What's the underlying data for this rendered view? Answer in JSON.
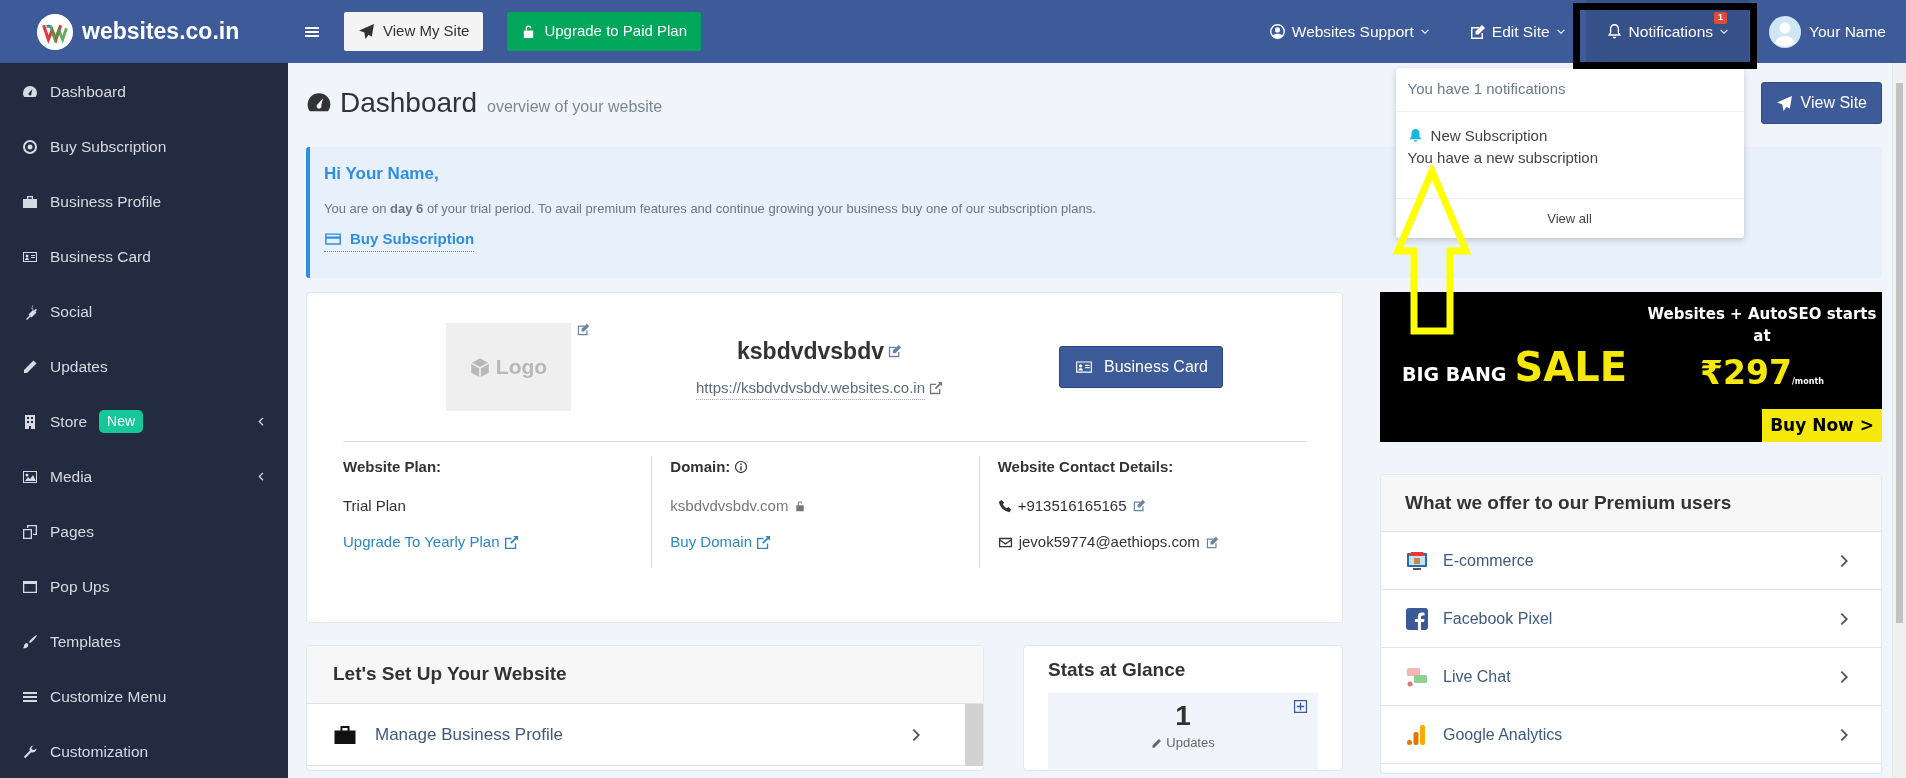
{
  "brand": {
    "name": "websites.co.in"
  },
  "topbar": {
    "buttons": [
      {
        "label": "View My Site",
        "kind": "light"
      },
      {
        "label": "Upgrade to Paid Plan",
        "kind": "success"
      }
    ],
    "menus": [
      {
        "label": "Websites Support"
      },
      {
        "label": "Edit Site"
      }
    ],
    "notifications": {
      "label": "Notifications",
      "badge": "1",
      "expanded": true
    },
    "user": {
      "name": "Your Name"
    }
  },
  "notification_menu": {
    "header": "You have 1 notifications",
    "items": [
      {
        "title": "New Subscription",
        "text": "You have a new subscription"
      }
    ],
    "footer": "View all"
  },
  "sidebar": {
    "items": [
      {
        "label": "Dashboard",
        "expandable": false
      },
      {
        "label": "Buy Subscription",
        "expandable": false
      },
      {
        "label": "Business Profile",
        "expandable": false
      },
      {
        "label": "Business Card",
        "expandable": false
      },
      {
        "label": "Social",
        "expandable": false
      },
      {
        "label": "Updates",
        "expandable": false
      },
      {
        "label": "Store",
        "badge": "New",
        "expandable": true
      },
      {
        "label": "Media",
        "expandable": true
      },
      {
        "label": "Pages",
        "expandable": false
      },
      {
        "label": "Pop Ups",
        "expandable": false
      },
      {
        "label": "Templates",
        "expandable": false
      },
      {
        "label": "Customize Menu",
        "expandable": false
      },
      {
        "label": "Customization",
        "expandable": false
      }
    ]
  },
  "page_header": {
    "title": "Dashboard",
    "subtitle": "overview of your website",
    "button": "View Site"
  },
  "alert": {
    "greeting": "Hi Your Name,",
    "message": "You are on **day 6** of your trial period. To avail premium features and continue growing your business buy one of our subscription plans.",
    "link": "Buy Subscription"
  },
  "profile": {
    "logo_label": "Logo",
    "site_name": "ksbdvdvsbdv",
    "url": "https://ksbdvdvsbdv.websites.co.in",
    "button": "Business Card",
    "details": [
      {
        "kind": "plan",
        "heading": "Website Plan:",
        "value": "Trial Plan",
        "link": "Upgrade To Yearly Plan"
      },
      {
        "kind": "domain",
        "heading": "Domain:",
        "value": "ksbdvdvsbdv.com",
        "link": "Buy Domain"
      },
      {
        "kind": "contact",
        "heading": "Website Contact Details:",
        "phone": "+913516165165",
        "email": "jevok59774@aethiops.com"
      }
    ]
  },
  "setup": {
    "title": "Let's Set Up Your Website",
    "items": [
      {
        "label": "Manage Business Profile"
      }
    ]
  },
  "stats": {
    "title": "Stats at Glance",
    "tiles": [
      {
        "value": "1",
        "label": "Updates"
      }
    ]
  },
  "banner": {
    "lead": "BIG BANG",
    "highlight": "SALE",
    "offer": "Websites + AutoSEO starts at",
    "price": "₹297",
    "unit": "/month",
    "cta": "Buy Now >"
  },
  "premium": {
    "title": "What we offer to our Premium users",
    "items": [
      {
        "label": "E-commerce"
      },
      {
        "label": "Facebook Pixel"
      },
      {
        "label": "Live Chat"
      },
      {
        "label": "Google Analytics"
      }
    ]
  }
}
